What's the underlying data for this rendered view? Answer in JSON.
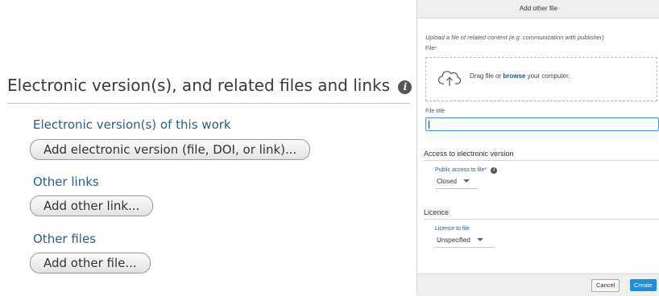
{
  "left": {
    "heading": "Electronic version(s), and related files and links",
    "info_icon": "i",
    "electronic": {
      "label": "Electronic version(s) of this work",
      "button": "Add electronic version (file, DOI, or link)..."
    },
    "links": {
      "label": "Other links",
      "button": "Add other link..."
    },
    "files": {
      "label": "Other files",
      "button": "Add other file..."
    }
  },
  "modal": {
    "title": "Add other file",
    "description": "Upload a file of related content (e.g. communication with publisher)",
    "file_label": "File",
    "required_mark": "*",
    "drop_prefix": "Drag file or",
    "drop_browse": "browse",
    "drop_suffix": "your computer.",
    "file_title_label": "File title",
    "file_title_value": "",
    "access_section": "Access to electronic version",
    "public_access_label": "Public access to file",
    "public_access_value": "Closed",
    "licence_section": "Licence",
    "licence_label": "Licence to file",
    "licence_value": "Unspecified",
    "cancel_button": "Cancel",
    "create_button": "Create"
  },
  "icons": {
    "info": "info-icon",
    "upload": "cloud-upload-icon",
    "dropdown": "chevron-down-icon"
  },
  "colors": {
    "link_blue": "#2c5d8a",
    "primary_button": "#1a8fdb",
    "required": "#d9334a"
  }
}
